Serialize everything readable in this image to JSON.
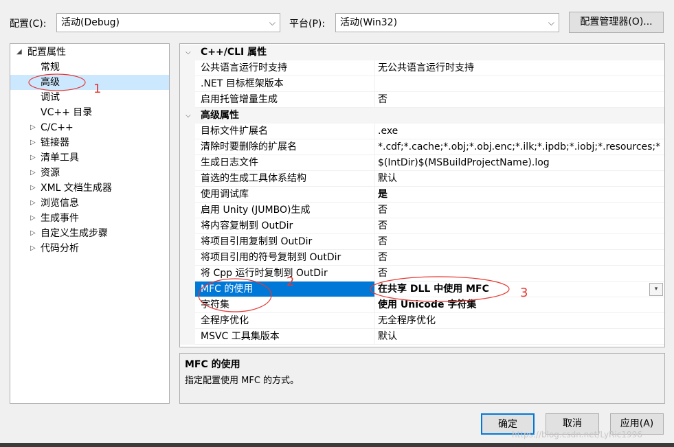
{
  "toolbar": {
    "config_label": "配置(C):",
    "config_value": "活动(Debug)",
    "platform_label": "平台(P):",
    "platform_value": "活动(Win32)",
    "config_manager_button": "配置管理器(O)..."
  },
  "tree": {
    "root": "配置属性",
    "items": [
      "常规",
      "高级",
      "调试",
      "VC++ 目录",
      "C/C++",
      "链接器",
      "清单工具",
      "资源",
      "XML 文档生成器",
      "浏览信息",
      "生成事件",
      "自定义生成步骤",
      "代码分析"
    ]
  },
  "grid": {
    "cat1": "C++/CLI 属性",
    "cat1_rows": [
      {
        "name": "公共语言运行时支持",
        "value": "无公共语言运行时支持"
      },
      {
        "name": ".NET 目标框架版本",
        "value": ""
      },
      {
        "name": "启用托管增量生成",
        "value": "否"
      }
    ],
    "cat2": "高级属性",
    "cat2_rows": [
      {
        "name": "目标文件扩展名",
        "value": ".exe"
      },
      {
        "name": "清除时要删除的扩展名",
        "value": "*.cdf;*.cache;*.obj;*.obj.enc;*.ilk;*.ipdb;*.iobj;*.resources;*"
      },
      {
        "name": "生成日志文件",
        "value": "$(IntDir)$(MSBuildProjectName).log"
      },
      {
        "name": "首选的生成工具体系结构",
        "value": "默认"
      },
      {
        "name": "使用调试库",
        "value": "是"
      },
      {
        "name": "启用 Unity (JUMBO)生成",
        "value": "否"
      },
      {
        "name": "将内容复制到 OutDir",
        "value": "否"
      },
      {
        "name": "将项目引用复制到 OutDir",
        "value": "否"
      },
      {
        "name": "将项目引用的符号复制到 OutDir",
        "value": "否"
      },
      {
        "name": "将 Cpp 运行时复制到 OutDir",
        "value": "否"
      },
      {
        "name": "MFC 的使用",
        "value": "在共享 DLL 中使用 MFC"
      },
      {
        "name": "字符集",
        "value": "使用 Unicode 字符集"
      },
      {
        "name": "全程序优化",
        "value": "无全程序优化"
      },
      {
        "name": "MSVC 工具集版本",
        "value": "默认"
      }
    ]
  },
  "description": {
    "title": "MFC 的使用",
    "text": "指定配置使用 MFC 的方式。"
  },
  "buttons": {
    "ok": "确定",
    "cancel": "取消",
    "apply": "应用(A)"
  },
  "annotations": {
    "a1": "1",
    "a2": "2",
    "a3": "3"
  },
  "watermark": "https://blog.csdn.net/LyRic1996",
  "colors": {
    "selection": "#0078d7",
    "tree_selection": "#cce8ff",
    "annotation": "#e53935"
  }
}
